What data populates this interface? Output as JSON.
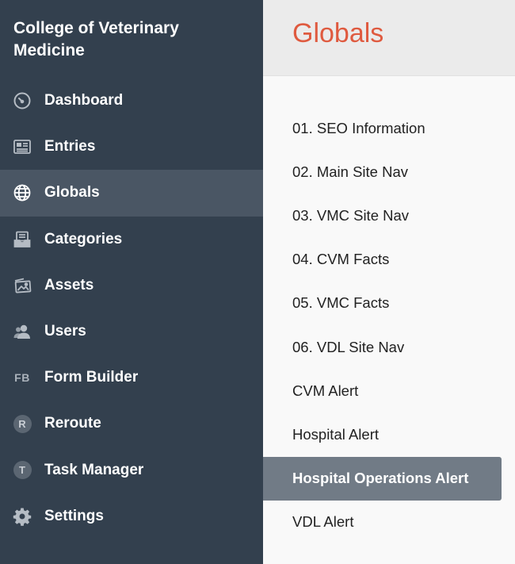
{
  "sidebar": {
    "site_name": "College of Veterinary Medicine",
    "items": [
      {
        "label": "Dashboard",
        "icon": "gauge-icon"
      },
      {
        "label": "Entries",
        "icon": "newspaper-icon"
      },
      {
        "label": "Globals",
        "icon": "globe-icon",
        "active": true
      },
      {
        "label": "Categories",
        "icon": "tray-icon"
      },
      {
        "label": "Assets",
        "icon": "images-icon"
      },
      {
        "label": "Users",
        "icon": "users-icon"
      },
      {
        "label": "Form Builder",
        "icon": "fb-text-icon",
        "badge": "FB"
      },
      {
        "label": "Reroute",
        "icon": "letter-r-icon",
        "badge": "R"
      },
      {
        "label": "Task Manager",
        "icon": "letter-t-icon",
        "badge": "T"
      },
      {
        "label": "Settings",
        "icon": "gear-icon"
      }
    ]
  },
  "main": {
    "title": "Globals",
    "globals": [
      "01. SEO Information",
      "02. Main Site Nav",
      "03. VMC Site Nav",
      "04. CVM Facts",
      "05. VMC Facts",
      "06. VDL Site Nav",
      "CVM Alert",
      "Hospital Alert",
      "Hospital Operations Alert",
      "VDL Alert"
    ],
    "selected_index": 8
  },
  "colors": {
    "sidebar_bg": "#33404e",
    "sidebar_active_bg": "#4a5664",
    "title_accent": "#df5a3f",
    "selected_item_bg": "#717b86"
  }
}
